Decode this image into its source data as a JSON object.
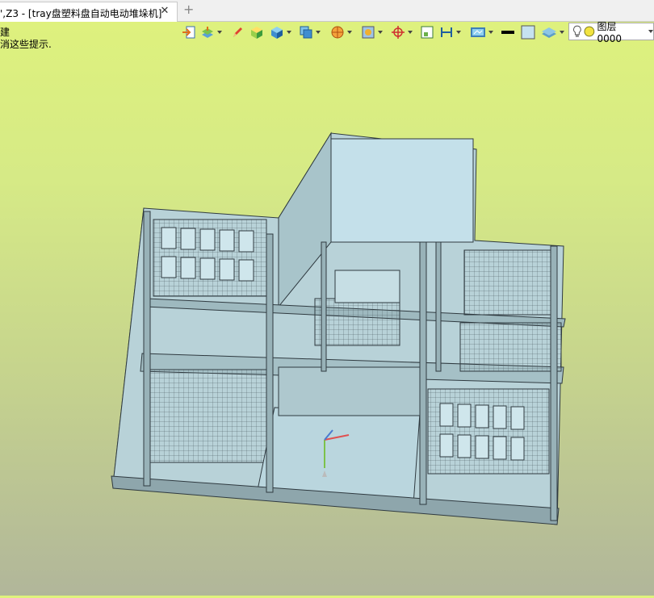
{
  "window": {
    "tab_title": "',Z3 - [tray盘塑料盘自动电动堆垛机]",
    "tab_close": "✕",
    "new_tab": "+"
  },
  "hints": {
    "line1": "建",
    "line2": "消这些提示."
  },
  "toolbar": {
    "icons": [
      "exit-icon",
      "layers-toolbar-icon",
      "pencil-icon",
      "shaded-cube-icon",
      "solid-cube-icon",
      "wireframe-cube-icon",
      "render-sphere-icon",
      "texture-icon",
      "target-icon",
      "frame-view-icon",
      "dimension-icon",
      "display-settings-icon",
      "line-color-swatch",
      "face-color-swatch",
      "layer-stack-icon"
    ],
    "colors": {
      "line": "#000000",
      "face": "#c6e2f0"
    },
    "layer_select": {
      "label": "图层0000",
      "icons": [
        "lightbulb-icon",
        "layer-status-dot"
      ]
    }
  },
  "viewport": {
    "model": "tray-stacker-assembly",
    "background_top": "#dff27c",
    "background_bottom": "#b1b69a",
    "part_color": "#bcd6dc",
    "edge_color": "#2f3a40"
  }
}
